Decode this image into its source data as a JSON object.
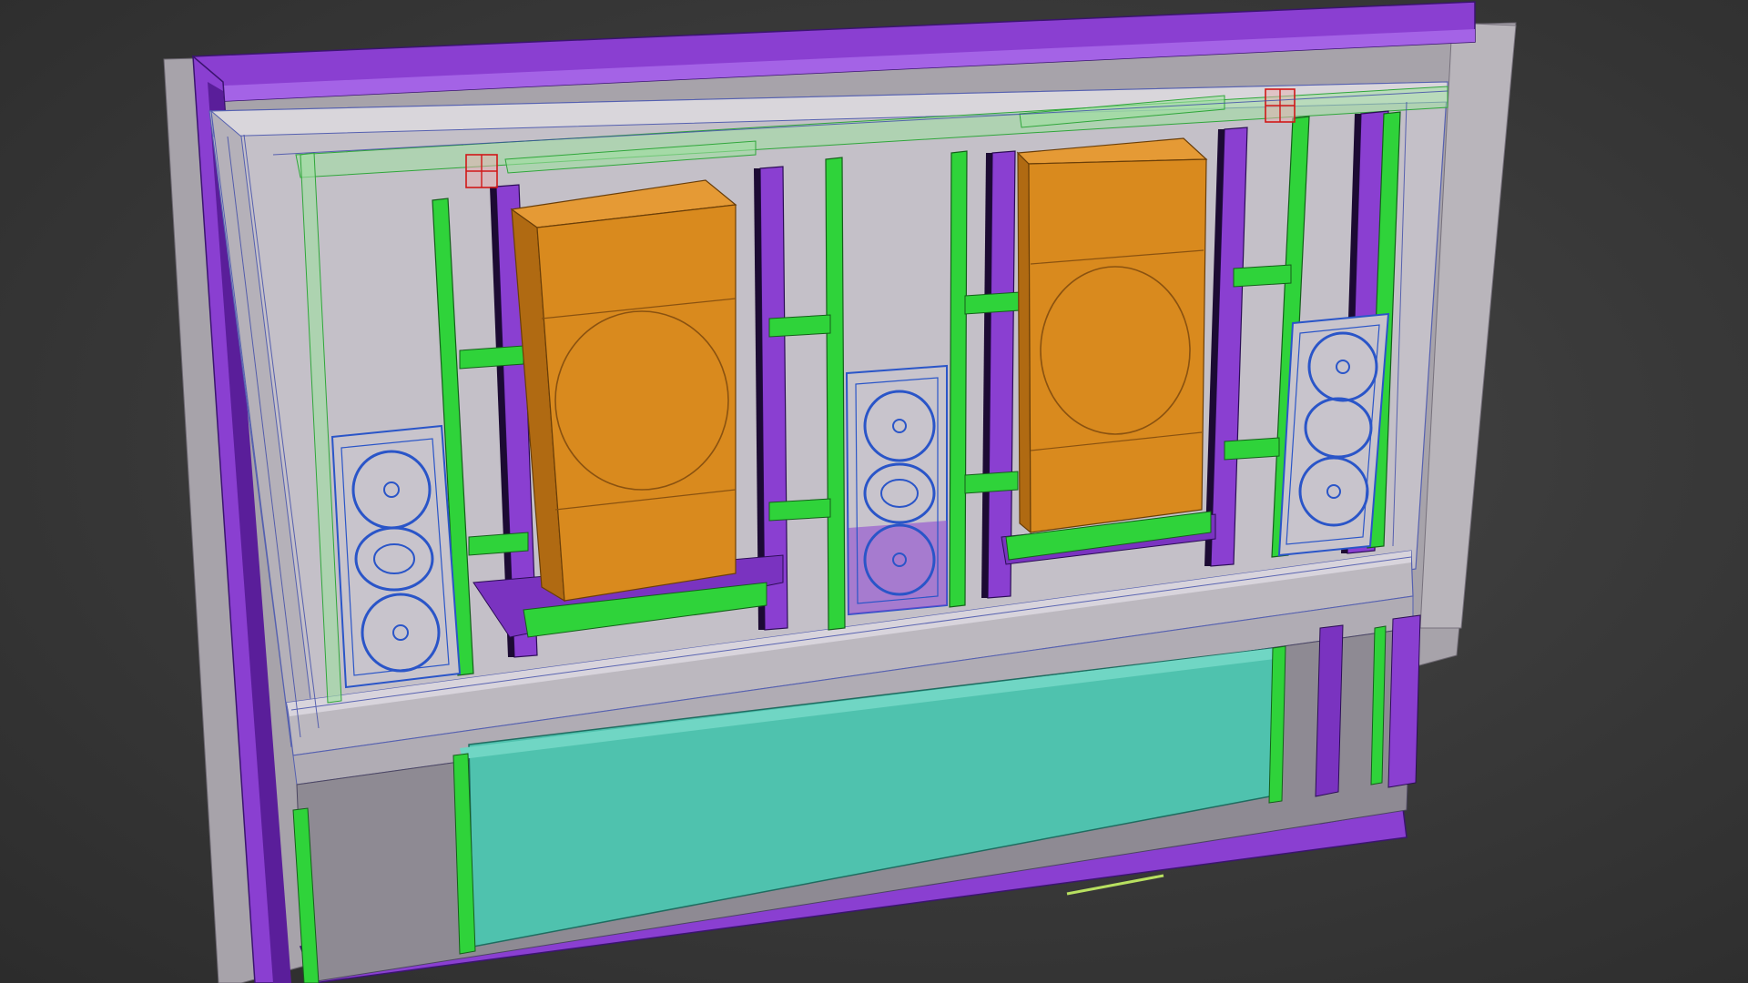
{
  "viewport": {
    "name": "perspective-viewport",
    "background_top": "#4a4a4a",
    "background_bottom": "#2c2c2c"
  },
  "scene": {
    "objects": [
      {
        "id": "outer-frame",
        "kind": "wall-frame",
        "color": "#8a3fd1"
      },
      {
        "id": "inner-panel",
        "kind": "panel",
        "color": "#c4c0c8"
      },
      {
        "id": "subwoofer-left",
        "kind": "subwoofer-cabinet",
        "color": "#d98a1e"
      },
      {
        "id": "subwoofer-right",
        "kind": "subwoofer-cabinet",
        "color": "#d98a1e"
      },
      {
        "id": "speaker-left",
        "kind": "in-wall-speaker",
        "color": "#2a55c8"
      },
      {
        "id": "speaker-center",
        "kind": "in-wall-speaker",
        "color": "#2a55c8"
      },
      {
        "id": "speaker-right",
        "kind": "in-wall-speaker",
        "color": "#2a55c8"
      },
      {
        "id": "screen-panel",
        "kind": "screen",
        "color": "#4fc2ae"
      }
    ],
    "colors": {
      "frame_purple": "#8a3fd1",
      "frame_purple_dark": "#5a1e9a",
      "stud_green": "#2fd33a",
      "stud_green_dark": "#1e8a26",
      "panel_grey": "#c9c5cc",
      "panel_light": "#d9d6db",
      "cabinet_orange": "#d98a1e",
      "cabinet_orange_dark": "#b06a12",
      "speaker_blue": "#2a55c8",
      "screen_teal": "#4fc2ae",
      "marker_red": "#d01818",
      "gizmo_yellow": "#b8e060"
    }
  }
}
